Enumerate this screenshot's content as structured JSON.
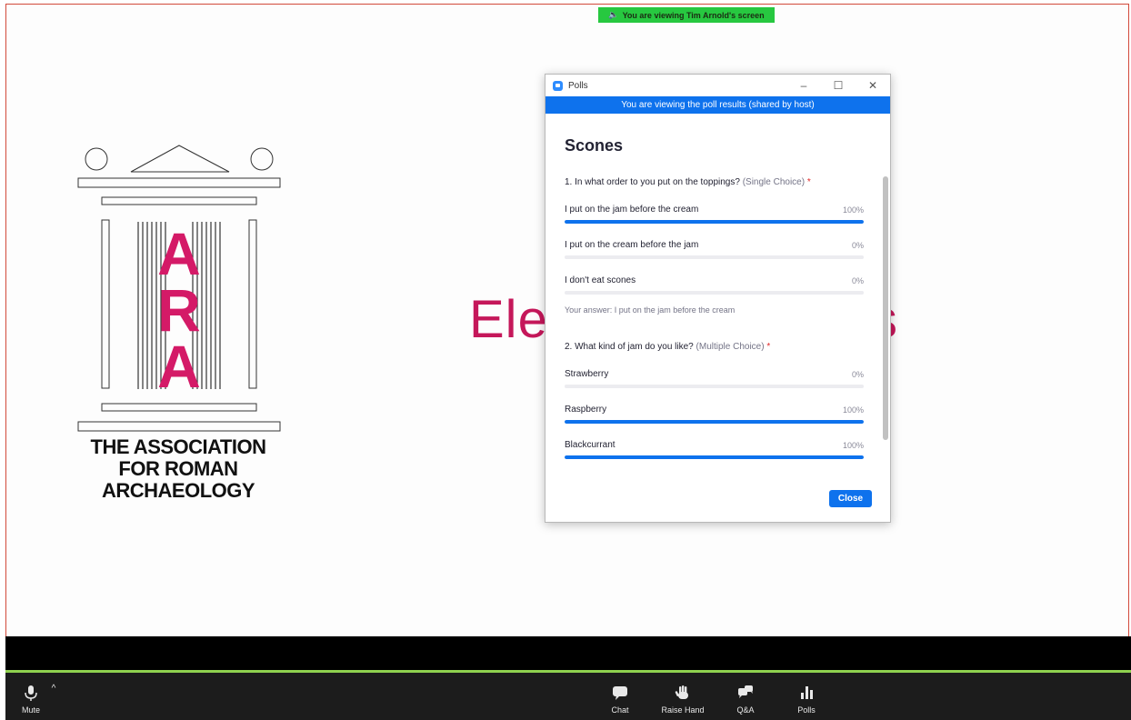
{
  "share_banner": {
    "text": "You are viewing Tim Arnold's screen"
  },
  "slide": {
    "logo_letters": [
      "A",
      "R",
      "A"
    ],
    "logo_text": [
      "THE ASSOCIATION",
      "FOR ROMAN",
      "ARCHAEOLOGY"
    ],
    "title_left": "Elec",
    "title_right": "s",
    "accent_color": "#c5175a"
  },
  "polls_window": {
    "title": "Polls",
    "banner": "You are viewing the poll results (shared by host)",
    "poll_title": "Scones",
    "questions": [
      {
        "text": "1. In what order to you put on the toppings?",
        "type": "(Single Choice)",
        "required_mark": "*",
        "options": [
          {
            "label": "I put on the jam before the cream",
            "percent_text": "100%",
            "fraction": 1.0
          },
          {
            "label": "I put on the cream before the jam",
            "percent_text": "0%",
            "fraction": 0.0
          },
          {
            "label": "I don't eat scones",
            "percent_text": "0%",
            "fraction": 0.0
          }
        ],
        "your_answer": "Your answer: I put on the jam before the cream"
      },
      {
        "text": "2. What kind of jam do you like?",
        "type": "(Multiple Choice)",
        "required_mark": "*",
        "options": [
          {
            "label": "Strawberry",
            "percent_text": "0%",
            "fraction": 0.0
          },
          {
            "label": "Raspberry",
            "percent_text": "100%",
            "fraction": 1.0
          },
          {
            "label": "Blackcurrant",
            "percent_text": "100%",
            "fraction": 1.0
          }
        ]
      }
    ],
    "close_label": "Close",
    "accent_color": "#0e72ed"
  },
  "toolbar": {
    "mute_label": "Mute",
    "items": [
      {
        "label": "Chat",
        "icon": "chat-icon"
      },
      {
        "label": "Raise Hand",
        "icon": "raise-hand-icon"
      },
      {
        "label": "Q&A",
        "icon": "qa-icon"
      },
      {
        "label": "Polls",
        "icon": "polls-icon"
      }
    ]
  }
}
